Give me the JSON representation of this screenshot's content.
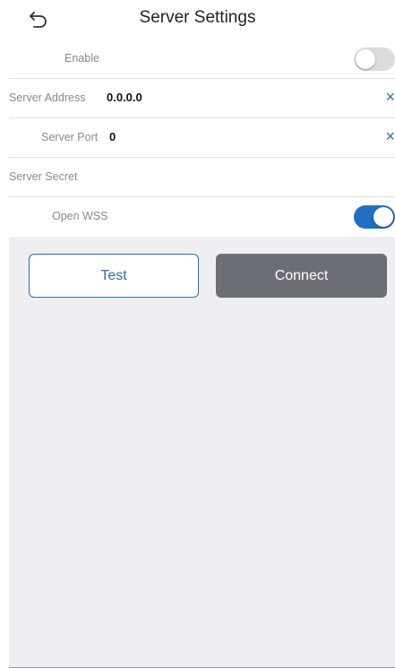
{
  "header": {
    "title": "Server Settings",
    "back_icon": "back-arrow-icon"
  },
  "settings": {
    "enable": {
      "label": "Enable",
      "on": false
    },
    "server_address": {
      "label": "Server Address",
      "value": "0.0.0.0",
      "clear_icon": "×"
    },
    "server_port": {
      "label": "Server Port",
      "value": "0",
      "clear_icon": "×"
    },
    "server_secret": {
      "label": "Server Secret",
      "value": ""
    },
    "open_wss": {
      "label": "Open WSS",
      "on": true
    }
  },
  "buttons": {
    "test_label": "Test",
    "connect_label": "Connect"
  },
  "colors": {
    "accent": "#2a6db5",
    "toggle_on": "#1f6fc2",
    "connect_bg": "#6b6f75",
    "background": "#eeeef3"
  }
}
